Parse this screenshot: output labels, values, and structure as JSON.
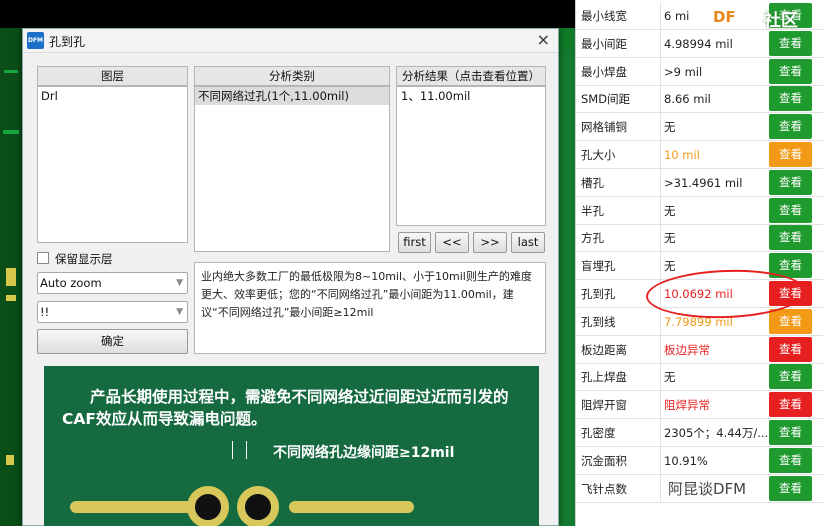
{
  "dialog": {
    "title": "孔到孔",
    "app_icon": "DFM",
    "close_icon": "×",
    "layers_header": "图层",
    "layers": [
      "Drl"
    ],
    "category_header": "分析类别",
    "categories": [
      "不同网络过孔(1个,11.00mil)"
    ],
    "results_header": "分析结果（点击查看位置）",
    "results": [
      "1、11.00mil"
    ],
    "nav_buttons": [
      "first",
      "<<",
      ">>",
      "last"
    ],
    "keep_layers_label": "保留显示层",
    "zoom_select": "Auto zoom",
    "second_select": "!!",
    "ok_button": "确定",
    "description": "业内绝大多数工厂的最低极限为8~10mil、小于10mil则生产的难度更大、效率更低；您的“不同网络过孔”最小间距为11.00mil，建议“不同网络过孔”最小间距≥12mil",
    "banner_text": "产品长期使用过程中，需避免不同网络过近间距过近而引发的CAF效应从而导致漏电问题。",
    "banner_label": "不同网络孔边缘间距≥12mil"
  },
  "checklist": {
    "watermark_left": "DF",
    "watermark_right": "社区",
    "wechat_mark": "阿昆谈DFM",
    "rows": [
      {
        "name": "最小线宽",
        "value": "6 mi",
        "button": "查看",
        "status": "ok"
      },
      {
        "name": "最小间距",
        "value": "4.98994 mil",
        "button": "查看",
        "status": "ok"
      },
      {
        "name": "最小焊盘",
        "value": ">9 mil",
        "button": "查看",
        "status": "ok"
      },
      {
        "name": "SMD间距",
        "value": "8.66 mil",
        "button": "查看",
        "status": "ok"
      },
      {
        "name": "网格铺铜",
        "value": "无",
        "button": "查看",
        "status": "ok"
      },
      {
        "name": "孔大小",
        "value": "10 mil",
        "button": "查看",
        "status": "warn"
      },
      {
        "name": "槽孔",
        "value": ">31.4961 mil",
        "button": "查看",
        "status": "ok"
      },
      {
        "name": "半孔",
        "value": "无",
        "button": "查看",
        "status": "ok"
      },
      {
        "name": "方孔",
        "value": "无",
        "button": "查看",
        "status": "ok"
      },
      {
        "name": "盲埋孔",
        "value": "无",
        "button": "查看",
        "status": "ok"
      },
      {
        "name": "孔到孔",
        "value": "10.0692 mil",
        "button": "查看",
        "status": "error"
      },
      {
        "name": "孔到线",
        "value": "7.79899 mil",
        "button": "查看",
        "status": "warn"
      },
      {
        "name": "板边距离",
        "value": "板边异常",
        "button": "查看",
        "status": "error"
      },
      {
        "name": "孔上焊盘",
        "value": "无",
        "button": "查看",
        "status": "ok"
      },
      {
        "name": "阻焊开窗",
        "value": "阻焊异常",
        "button": "查看",
        "status": "error"
      },
      {
        "name": "孔密度",
        "value": "2305个；4.44万/...",
        "button": "查看",
        "status": "ok"
      },
      {
        "name": "沉金面积",
        "value": "10.91%",
        "button": "查看",
        "status": "ok"
      },
      {
        "name": "飞针点数",
        "value": "",
        "button": "查看",
        "status": "ok"
      }
    ],
    "colors": {
      "ok": "#1f9a2e",
      "warn": "#f29a16",
      "error": "#e62020",
      "warn_text": "#f29a16",
      "error_text": "#e62020"
    }
  }
}
